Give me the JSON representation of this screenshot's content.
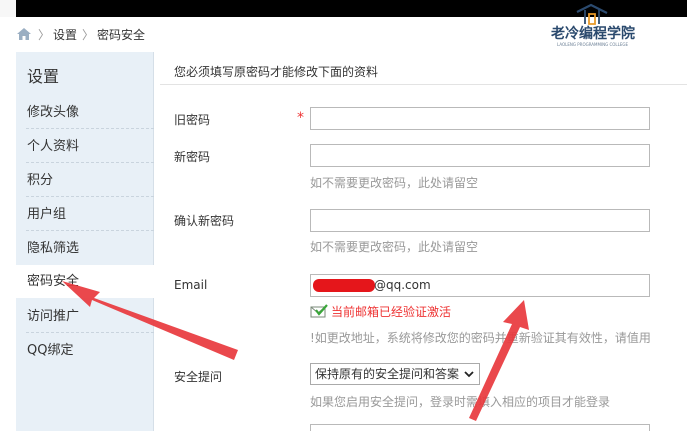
{
  "breadcrumb": {
    "items": [
      "设置",
      "密码安全"
    ],
    "home_icon": "home-icon"
  },
  "logo": {
    "text": "老冷编程学院",
    "subtext": "LAOLENG PROGRAMMING COLLEGE"
  },
  "sidebar": {
    "title": "设置",
    "items": [
      {
        "label": "修改头像"
      },
      {
        "label": "个人资料"
      },
      {
        "label": "积分"
      },
      {
        "label": "用户组"
      },
      {
        "label": "隐私筛选"
      },
      {
        "label": "密码安全",
        "active": true
      },
      {
        "label": "访问推广"
      },
      {
        "label": "QQ绑定"
      }
    ]
  },
  "form": {
    "notice": "您必须填写原密码才能修改下面的资料",
    "old_password_label": "旧密码",
    "required_mark": "*",
    "new_password_label": "新密码",
    "new_password_hint": "如不需要更改密码，此处请留空",
    "confirm_password_label": "确认新密码",
    "confirm_password_hint": "如不需要更改密码，此处请留空",
    "email_label": "Email",
    "email_value_visible": "@qq.com",
    "email_verified_text": "当前邮箱已经验证激活",
    "email_hint": "!如更改地址，系统将修改您的密码并重新验证其有效性，请值用",
    "security_question_label": "安全提问",
    "security_question_selected": "保持原有的安全提问和答案",
    "security_question_hint": "如果您启用安全提问，登录时需填入相应的项目才能登录"
  },
  "colors": {
    "annotation_arrow": "#e8383d",
    "sidebar_bg": "#e8f0f7",
    "required": "#ee3333"
  }
}
